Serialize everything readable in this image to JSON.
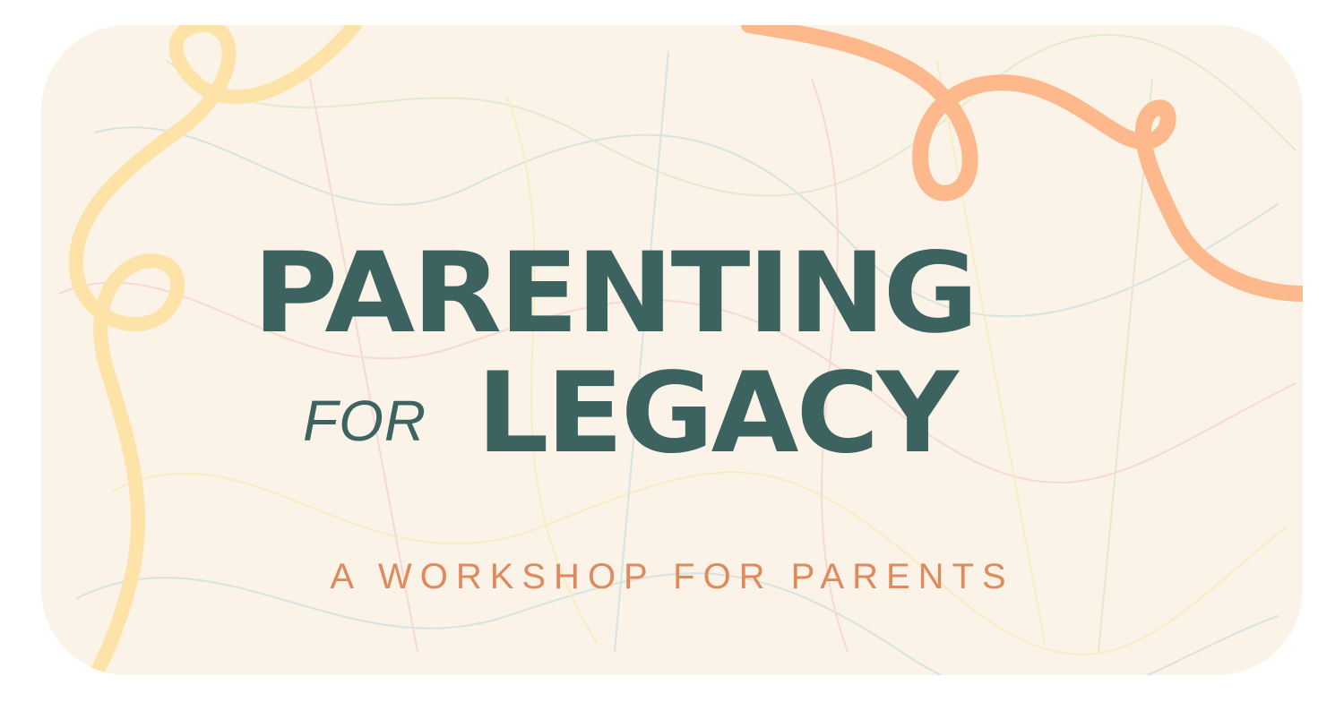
{
  "banner": {
    "title_line1": "PARENTING",
    "title_for": "FOR",
    "title_line2": "LEGACY",
    "subtitle": "A WORKSHOP FOR PARENTS"
  },
  "colors": {
    "background": "#fbf3e7",
    "title": "#3c6360",
    "subtitle": "#e08a5c",
    "left_squiggle": "#fde3a7",
    "right_squiggle": "#fdb98c"
  },
  "decorations": {
    "left": "yellow-squiggle-line",
    "right": "peach-squiggle-line",
    "texture": "crayon-scribble-texture"
  }
}
